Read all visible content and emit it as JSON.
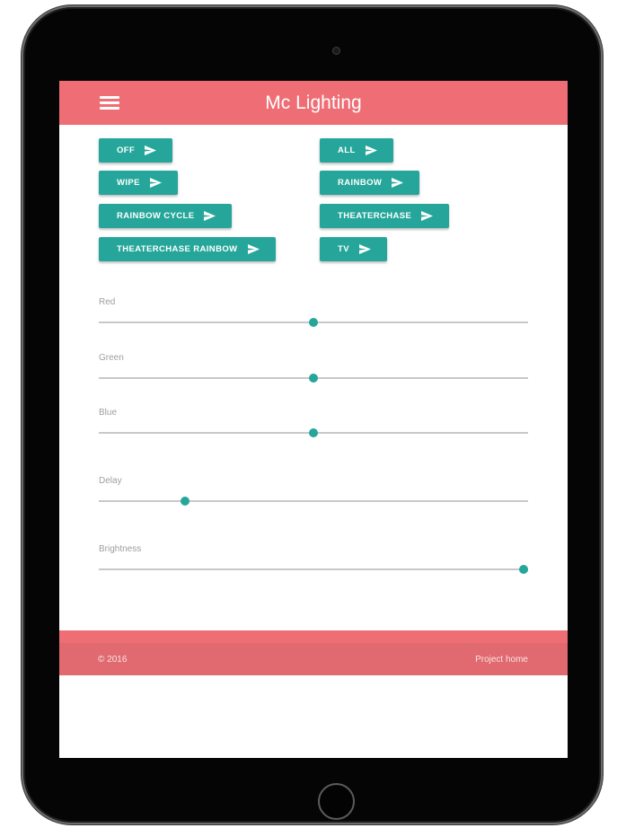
{
  "header": {
    "title": "Mc Lighting",
    "menu_icon": "hamburger-menu-icon"
  },
  "buttons": [
    {
      "id": "off",
      "label": "OFF",
      "icon": "send-icon"
    },
    {
      "id": "all",
      "label": "ALL",
      "icon": "send-icon"
    },
    {
      "id": "wipe",
      "label": "WIPE",
      "icon": "send-icon"
    },
    {
      "id": "rainbow",
      "label": "RAINBOW",
      "icon": "send-icon"
    },
    {
      "id": "rainbow-cycle",
      "label": "RAINBOW CYCLE",
      "icon": "send-icon"
    },
    {
      "id": "theaterchase",
      "label": "THEATERCHASE",
      "icon": "send-icon"
    },
    {
      "id": "theaterchase-rainbow",
      "label": "THEATERCHASE RAINBOW",
      "icon": "send-icon"
    },
    {
      "id": "tv",
      "label": "TV",
      "icon": "send-icon"
    }
  ],
  "sliders": [
    {
      "id": "red",
      "label": "Red",
      "level": 0.5
    },
    {
      "id": "green",
      "label": "Green",
      "level": 0.5
    },
    {
      "id": "blue",
      "label": "Blue",
      "level": 0.5
    },
    {
      "id": "delay",
      "label": "Delay",
      "level": 0.2
    },
    {
      "id": "brightness",
      "label": "Brightness",
      "level": 0.99
    }
  ],
  "footer": {
    "copyright": "© 2016",
    "project_link": "Project home"
  },
  "colors": {
    "header": "#ef6e75",
    "accent": "#26a69a",
    "footer": "#ee6e73"
  }
}
